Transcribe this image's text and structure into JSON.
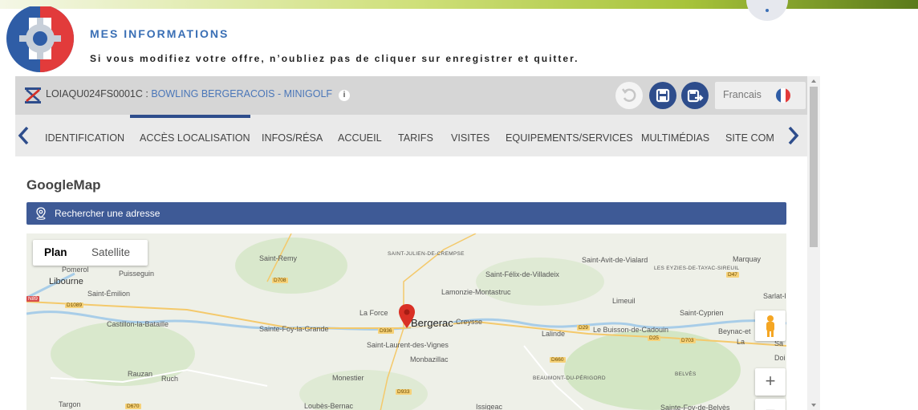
{
  "header": {
    "title": "MES INFORMATIONS",
    "subtitle": "Si vous modifiez votre offre, n’oubliez pas de cliquer sur enregistrer et quitter."
  },
  "record": {
    "code": "LOIAQU024FS0001C : ",
    "name": "BOWLING BERGERACOIS - MINIGOLF",
    "info_icon": "i",
    "language": "Francais"
  },
  "tabs": [
    {
      "label": "IDENTIFICATION"
    },
    {
      "label": "ACCÈS LOCALISATION"
    },
    {
      "label": "INFOS/RÉSA"
    },
    {
      "label": "ACCUEIL"
    },
    {
      "label": "TARIFS"
    },
    {
      "label": "VISITES"
    },
    {
      "label": "EQUIPEMENTS/SERVICES"
    },
    {
      "label": "MULTIMÉDIAS"
    },
    {
      "label": "SITE COMM"
    }
  ],
  "active_tab": "ACCÈS LOCALISATION",
  "section": {
    "title": "GoogleMap",
    "search_label": "Rechercher une adresse"
  },
  "map": {
    "type_options": [
      "Plan",
      "Satellite"
    ],
    "selected_type": "Plan",
    "zoom_in": "+",
    "zoom_out": "−",
    "places": [
      "Saint-Remy",
      "SAINT-JULIEN-DE-CREMPSE",
      "Saint-Avit-de-Vialard",
      "Marquay",
      "Pomerol",
      "Puisseguin",
      "LES EYZIES-DE-TAYAC-SIREUIL",
      "Libourne",
      "Saint-Félix-de-Villadeix",
      "Saint-Émilion",
      "Lamonzie-Montastruc",
      "Sarlat-l",
      "Limeuil",
      "La Force",
      "Saint-Cyprien",
      "Castillon-la-Bataille",
      "Sainte-Foy-la-Grande",
      "Bergerac",
      "Creysse",
      "Lalinde",
      "Le Buisson-de-Cadouin",
      "Beynac-et",
      "Saint-Laurent-des-Vignes",
      "Monbazillac",
      "Rauzan",
      "Ruch",
      "Monestier",
      "BEAUMONT-DU-PÉRIGORD",
      "BELVÈS",
      "Targon",
      "Loubès-Bernac",
      "Issigeac",
      "Sainte-Foy-de-Belvès",
      "La",
      "Doi",
      "ac",
      "Sa"
    ],
    "roads": [
      "D708",
      "D1089",
      "D936",
      "D29",
      "D25",
      "D703",
      "D660",
      "D933",
      "D670",
      "D47",
      "N89"
    ]
  },
  "colors": {
    "accent": "#2e4d8c",
    "search_bar": "#3e5a96",
    "title_blue": "#3a6fb5",
    "pin_red": "#d93025"
  }
}
